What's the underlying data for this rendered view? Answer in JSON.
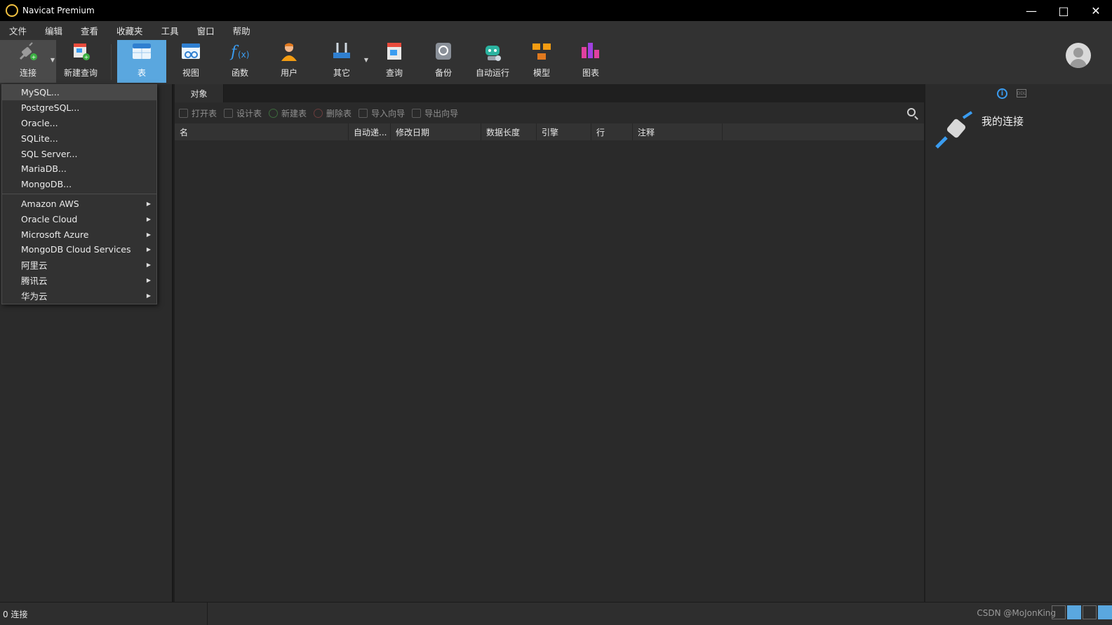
{
  "window": {
    "title": "Navicat Premium"
  },
  "menu": [
    "文件",
    "编辑",
    "查看",
    "收藏夹",
    "工具",
    "窗口",
    "帮助"
  ],
  "toolbar": {
    "connect": "连接",
    "new_query": "新建查询",
    "table": "表",
    "view": "视图",
    "function": "函数",
    "user": "用户",
    "other": "其它",
    "query": "查询",
    "backup": "备份",
    "automation": "自动运行",
    "model": "模型",
    "chart": "图表"
  },
  "tabs": [
    "对象"
  ],
  "object_toolbar": {
    "open_table": "打开表",
    "design_table": "设计表",
    "new_table": "新建表",
    "delete_table": "删除表",
    "import_wizard": "导入向导",
    "export_wizard": "导出向导"
  },
  "columns": [
    "名",
    "自动递...",
    "修改日期",
    "数据长度",
    "引擎",
    "行",
    "注释"
  ],
  "dropdown": {
    "databases": [
      "MySQL...",
      "PostgreSQL...",
      "Oracle...",
      "SQLite...",
      "SQL Server...",
      "MariaDB...",
      "MongoDB..."
    ],
    "clouds": [
      "Amazon AWS",
      "Oracle Cloud",
      "Microsoft Azure",
      "MongoDB Cloud Services",
      "阿里云",
      "腾讯云",
      "华为云"
    ]
  },
  "info_panel": {
    "title": "我的连接"
  },
  "status": {
    "connections": "0 连接",
    "watermark": "CSDN @MoJonKing"
  },
  "colors": {
    "accent": "#5aa7df",
    "info": "#3a9cf0"
  }
}
